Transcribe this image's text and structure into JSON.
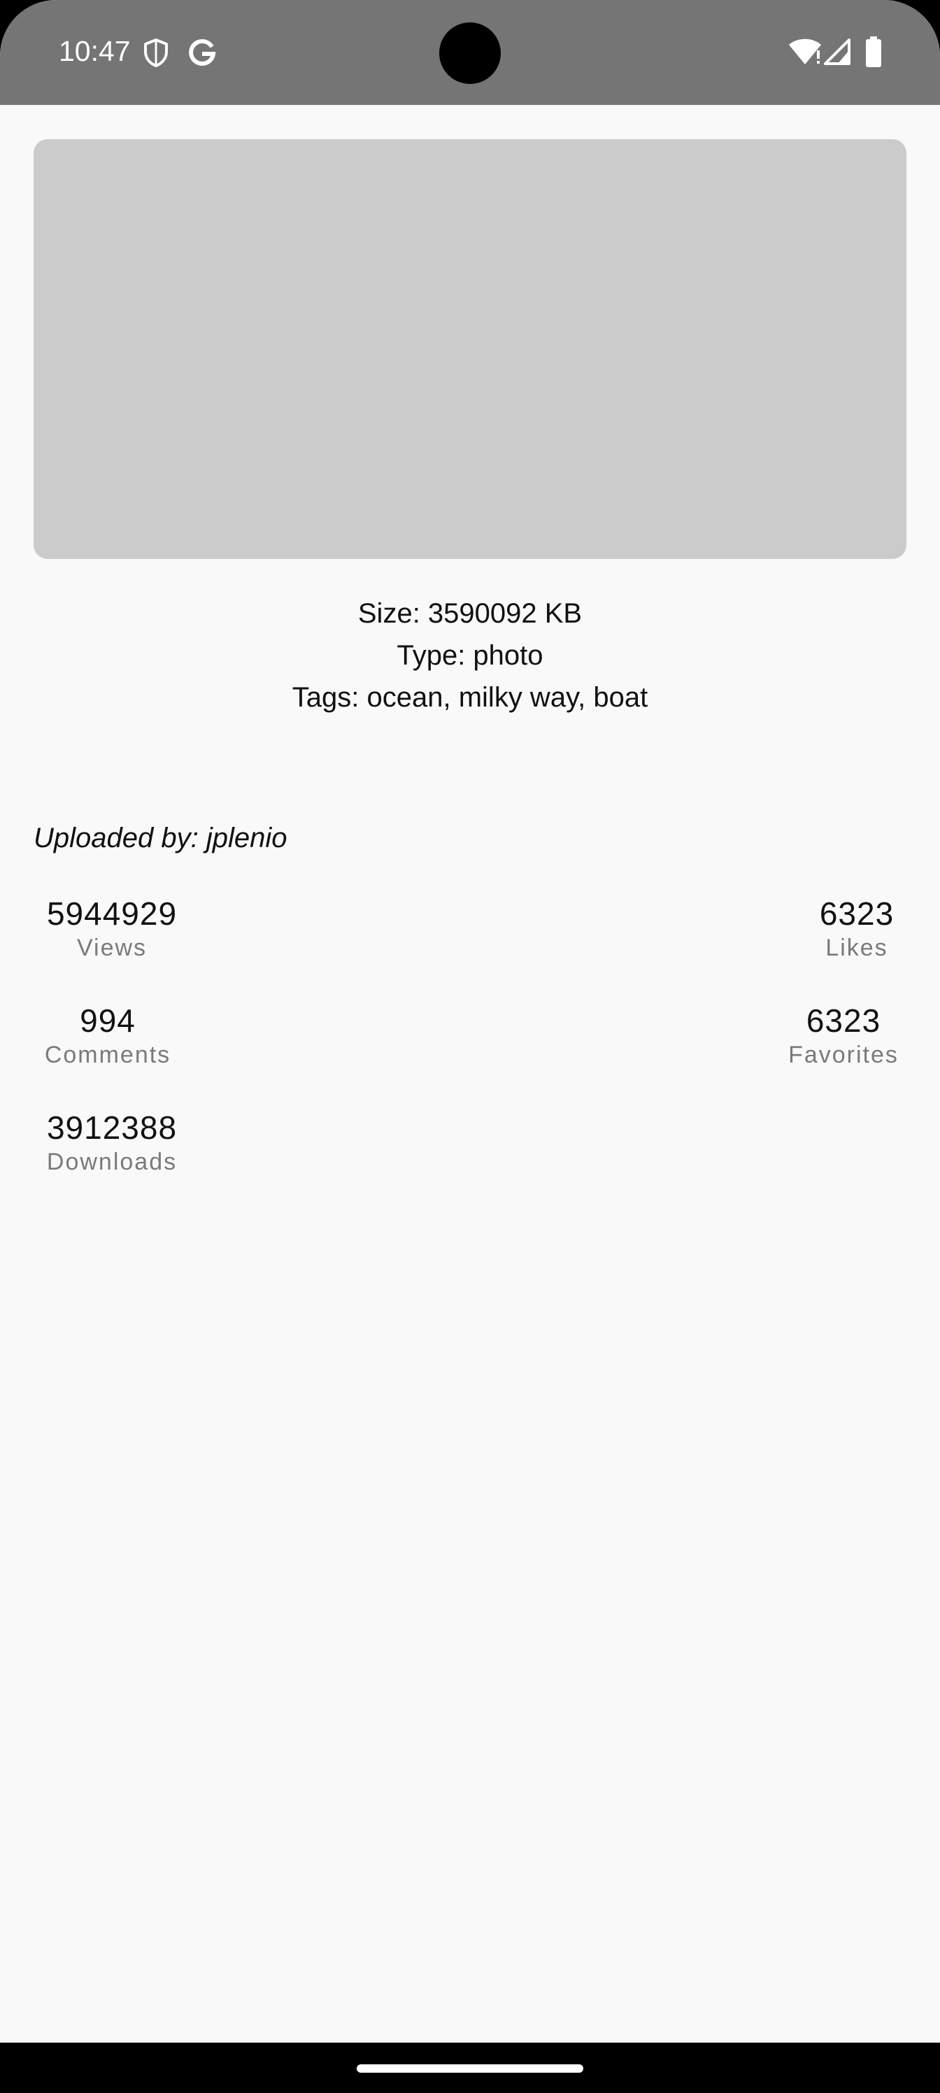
{
  "status_bar": {
    "time": "10:47",
    "background_color": "#757575",
    "left_icons": [
      "shield-icon",
      "google-icon"
    ],
    "right_icons": [
      "wifi-icon",
      "signal-icon",
      "battery-icon"
    ]
  },
  "image": {
    "placeholder_color": "#cbcbcb"
  },
  "details": {
    "size": "Size: 3590092 KB",
    "type": "Type: photo",
    "tags": "Tags: ocean, milky way, boat"
  },
  "uploader": "Uploaded by: jplenio",
  "stats": {
    "views": {
      "value": "5944929",
      "label": "Views"
    },
    "likes": {
      "value": "6323",
      "label": "Likes"
    },
    "comments": {
      "value": "994",
      "label": "Comments"
    },
    "favorites": {
      "value": "6323",
      "label": "Favorites"
    },
    "downloads": {
      "value": "3912388",
      "label": "Downloads"
    }
  }
}
